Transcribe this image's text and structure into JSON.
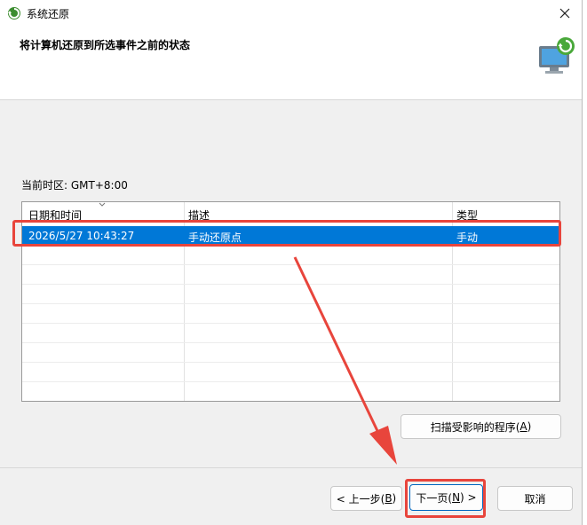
{
  "window": {
    "title": "系统还原",
    "icon": "system-restore-icon"
  },
  "header": {
    "title": "将计算机还原到所选事件之前的状态",
    "icon": "restore-monitor-icon"
  },
  "timezone_label": "当前时区: GMT+8:00",
  "table": {
    "columns": [
      "日期和时间",
      "描述",
      "类型"
    ],
    "rows": [
      {
        "date": "2026/5/27 10:43:27",
        "description": "手动还原点",
        "type": "手动",
        "selected": true
      }
    ]
  },
  "buttons": {
    "scan_prefix": "扫描受影响的程序(",
    "scan_key": "A",
    "scan_suffix": ")",
    "back_prefix": "< 上一步(",
    "back_key": "B",
    "back_suffix": ")",
    "next_prefix": "下一页(",
    "next_key": "N",
    "next_suffix": ") >",
    "cancel": "取消"
  },
  "colors": {
    "selection": "#0078d7",
    "annotation": "#e8453c",
    "accent": "#0067c0"
  }
}
